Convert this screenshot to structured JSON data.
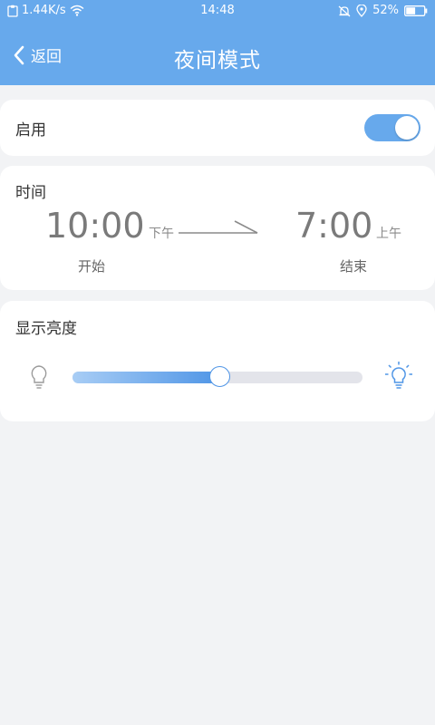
{
  "status_bar": {
    "speed": "1.44K/s",
    "time": "14:48",
    "battery": "52%",
    "battery_level": 0.52,
    "icons": [
      "clipboard-icon",
      "wifi-icon",
      "alarm-icon",
      "location-icon",
      "battery-icon"
    ]
  },
  "app_bar": {
    "back_label": "返回",
    "title": "夜间模式",
    "background_color": "#67a9ec"
  },
  "enable": {
    "label": "启用",
    "on": true,
    "accent_color": "#67a9ec"
  },
  "time": {
    "label": "时间",
    "start_time": "10:00",
    "start_period": "下午",
    "start_label": "开始",
    "end_time": "7:00",
    "end_period": "上午",
    "end_label": "结束"
  },
  "brightness": {
    "label": "显示亮度",
    "value": 0.51,
    "icons": [
      "bulb-dim-icon",
      "bulb-bright-icon"
    ]
  }
}
